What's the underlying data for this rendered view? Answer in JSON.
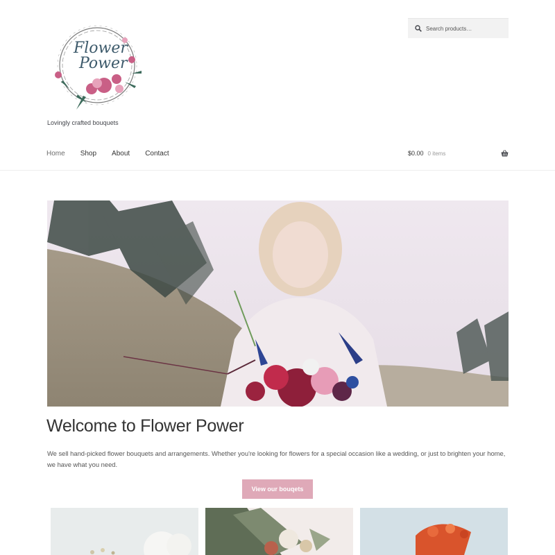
{
  "site": {
    "logo_text_line1": "Flower",
    "logo_text_line2": "Power",
    "tagline": "Lovingly crafted bouquets"
  },
  "search": {
    "placeholder": "Search products…",
    "icon": "search-icon"
  },
  "nav": {
    "items": [
      {
        "label": "Home"
      },
      {
        "label": "Shop"
      },
      {
        "label": "About"
      },
      {
        "label": "Contact"
      }
    ],
    "active": "Home"
  },
  "cart": {
    "amount": "$0.00",
    "count": "0 items",
    "icon": "basket-icon"
  },
  "main": {
    "title": "Welcome to Flower Power",
    "intro": "We sell hand-picked flower bouquets and arrangements. Whether you're looking for flowers for a special occasion like a wedding, or just to brighten your home, we have what you need.",
    "button_label": "View our bouqets"
  },
  "colors": {
    "accent": "#dfa9b8",
    "text": "#43454b",
    "search_bg": "#f2f2f2"
  }
}
